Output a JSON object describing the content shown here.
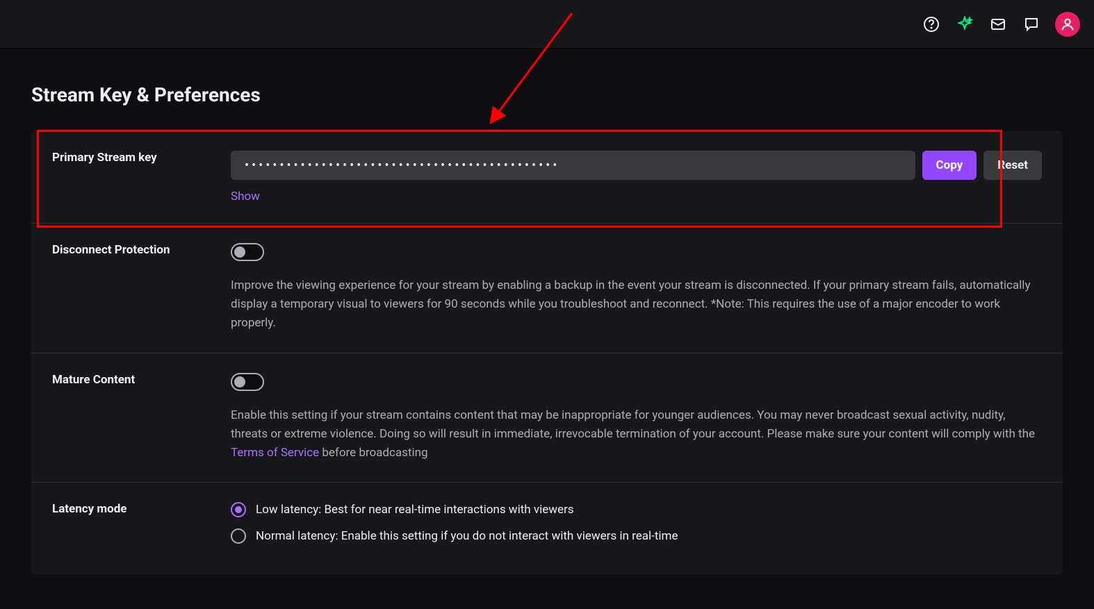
{
  "page_title": "Stream Key & Preferences",
  "topbar": {
    "icons": [
      "help",
      "sparkle",
      "inbox",
      "chat",
      "user"
    ]
  },
  "stream_key": {
    "label": "Primary Stream key",
    "masked_value": "•••••••••••••••••••••••••••••••••••••••••••••",
    "copy_button": "Copy",
    "reset_button": "Reset",
    "show_link": "Show"
  },
  "disconnect_protection": {
    "label": "Disconnect Protection",
    "enabled": false,
    "description": "Improve the viewing experience for your stream by enabling a backup in the event your stream is disconnected. If your primary stream fails, automatically display a temporary visual to viewers for 90 seconds while you troubleshoot and reconnect. *Note: This requires the use of a major encoder to work properly."
  },
  "mature_content": {
    "label": "Mature Content",
    "enabled": false,
    "description_before": "Enable this setting if your stream contains content that may be inappropriate for younger audiences. You may never broadcast sexual activity, nudity, threats or extreme violence. Doing so will result in immediate, irrevocable termination of your account. Please make sure your content will comply with the ",
    "tos_link": "Terms of Service",
    "description_after": " before broadcasting"
  },
  "latency_mode": {
    "label": "Latency mode",
    "options": [
      {
        "label": "Low latency: Best for near real-time interactions with viewers",
        "selected": true
      },
      {
        "label": "Normal latency: Enable this setting if you do not interact with viewers in real-time",
        "selected": false
      }
    ]
  }
}
